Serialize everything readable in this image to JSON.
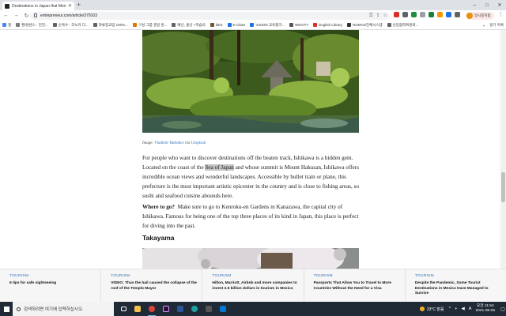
{
  "browser": {
    "tab_title": "Destinations in Japan that Men",
    "new_tab_symbol": "+",
    "url": "entrepreneur.com/article/379103",
    "profile_label": "일시중지됨",
    "menu_symbol": "⋮",
    "window_controls": [
      "–",
      "□",
      "✕"
    ]
  },
  "bookmarks": {
    "items": [
      {
        "label": "앱",
        "color": "#4285f4"
      },
      {
        "label": "편/센센스 : 진전...",
        "color": "#7b7b7b"
      },
      {
        "label": "순복수 - 코노커 디...",
        "color": "#5f6368"
      },
      {
        "label": "좌류종교업 100%...",
        "color": "#5f6368"
      },
      {
        "label": "구성 그룹 결방 원...",
        "color": "#e37400"
      },
      {
        "label": "배선, 울산 +학습의",
        "color": "#5f6368"
      },
      {
        "label": "ikIIS",
        "color": "#6b5b2e"
      },
      {
        "label": "E-Class",
        "color": "#1a73e8"
      },
      {
        "label": "VISION 교육평가...",
        "color": "#1a73e8"
      },
      {
        "label": "WEVITY",
        "color": "#555555"
      },
      {
        "label": "English Library",
        "color": "#d93025"
      },
      {
        "label": "NOMAD전체시스템",
        "color": "#333333"
      },
      {
        "label": "산업협력획원회...",
        "color": "#5f6368"
      }
    ],
    "more_label": "»",
    "reading_list_label": "읽기 목록"
  },
  "article": {
    "caption_prefix": "Image: ",
    "caption_author": "Vladimir Haltakov",
    "caption_via": " via ",
    "caption_source": "Unsplash",
    "p1_before": "For people who want to discover destinations off the beaten track, Ishikawa is a hidden gem. Located on the coast of the ",
    "p1_highlight": "Sea of Japan",
    "p1_after": " and whose summit is Mount Hakusan, Ishikawa offers incredible ocean views and wonderful landscapes. Accessible by bullet train or plane, this prefecture is the most important artistic epicenter in the country and is close to fishing areas, so sushi and seafood cuisine abounds here.",
    "p2_lead": "Where to go?",
    "p2_text": "  Make sure to go to Kenroku-en Gardens in Kanazawa, the capital city of Ishikawa. Famous for being one of the top three places of its kind in Japan, this place is perfect for diving into the past.",
    "section_heading": "Takayama"
  },
  "recommendations": [
    {
      "category": "TOURISM",
      "title": "6 tips for safe sightseeing"
    },
    {
      "category": "TOURISM",
      "title": "VIDEO: Thus the hail caused the collapse of the roof of the Templo Mayor"
    },
    {
      "category": "TOURISM",
      "title": "Hilton, Marriott, Airbnb and more companies to invest 2.5 billion dollars in tourism in Mexico"
    },
    {
      "category": "TOURISM",
      "title": "Passports That Allow You to Travel to More Countries Without the Need for a Visa"
    },
    {
      "category": "TOURISM",
      "title": "Despite the Pandemic, Some Tourist Destinations in Mexico Have Managed to Survive"
    }
  ],
  "taskbar": {
    "search_placeholder": "검색하려면 여기에 입력하십시오.",
    "weather": "33°C 맑음",
    "ime": "A",
    "time": "오전 11:54",
    "date": "2021-08-06"
  }
}
